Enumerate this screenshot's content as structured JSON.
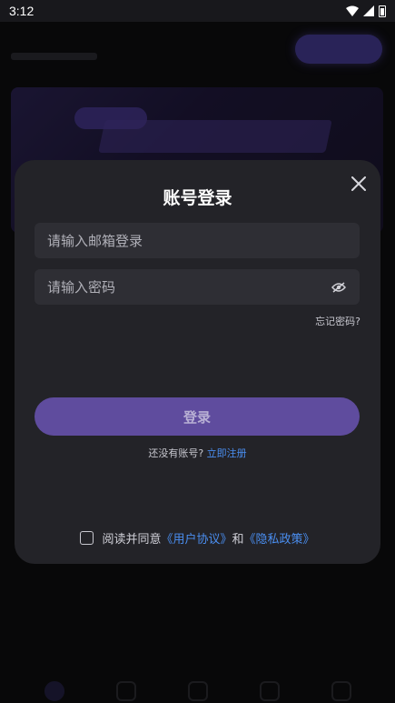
{
  "status_bar": {
    "time": "3:12"
  },
  "modal": {
    "title": "账号登录",
    "email_placeholder": "请输入邮箱登录",
    "password_placeholder": "请输入密码",
    "forgot_password": "忘记密码?",
    "login_button": "登录",
    "no_account_text": "还没有账号?",
    "register_link": "立即注册",
    "agree_prefix": "阅读并同意",
    "user_agreement": "《用户协议》",
    "and_text": "和",
    "privacy_policy": "《隐私政策》"
  },
  "colors": {
    "accent": "#5f4c9e",
    "link": "#4a8ef0",
    "modal_bg": "#232328",
    "field_bg": "#2e2e34"
  }
}
